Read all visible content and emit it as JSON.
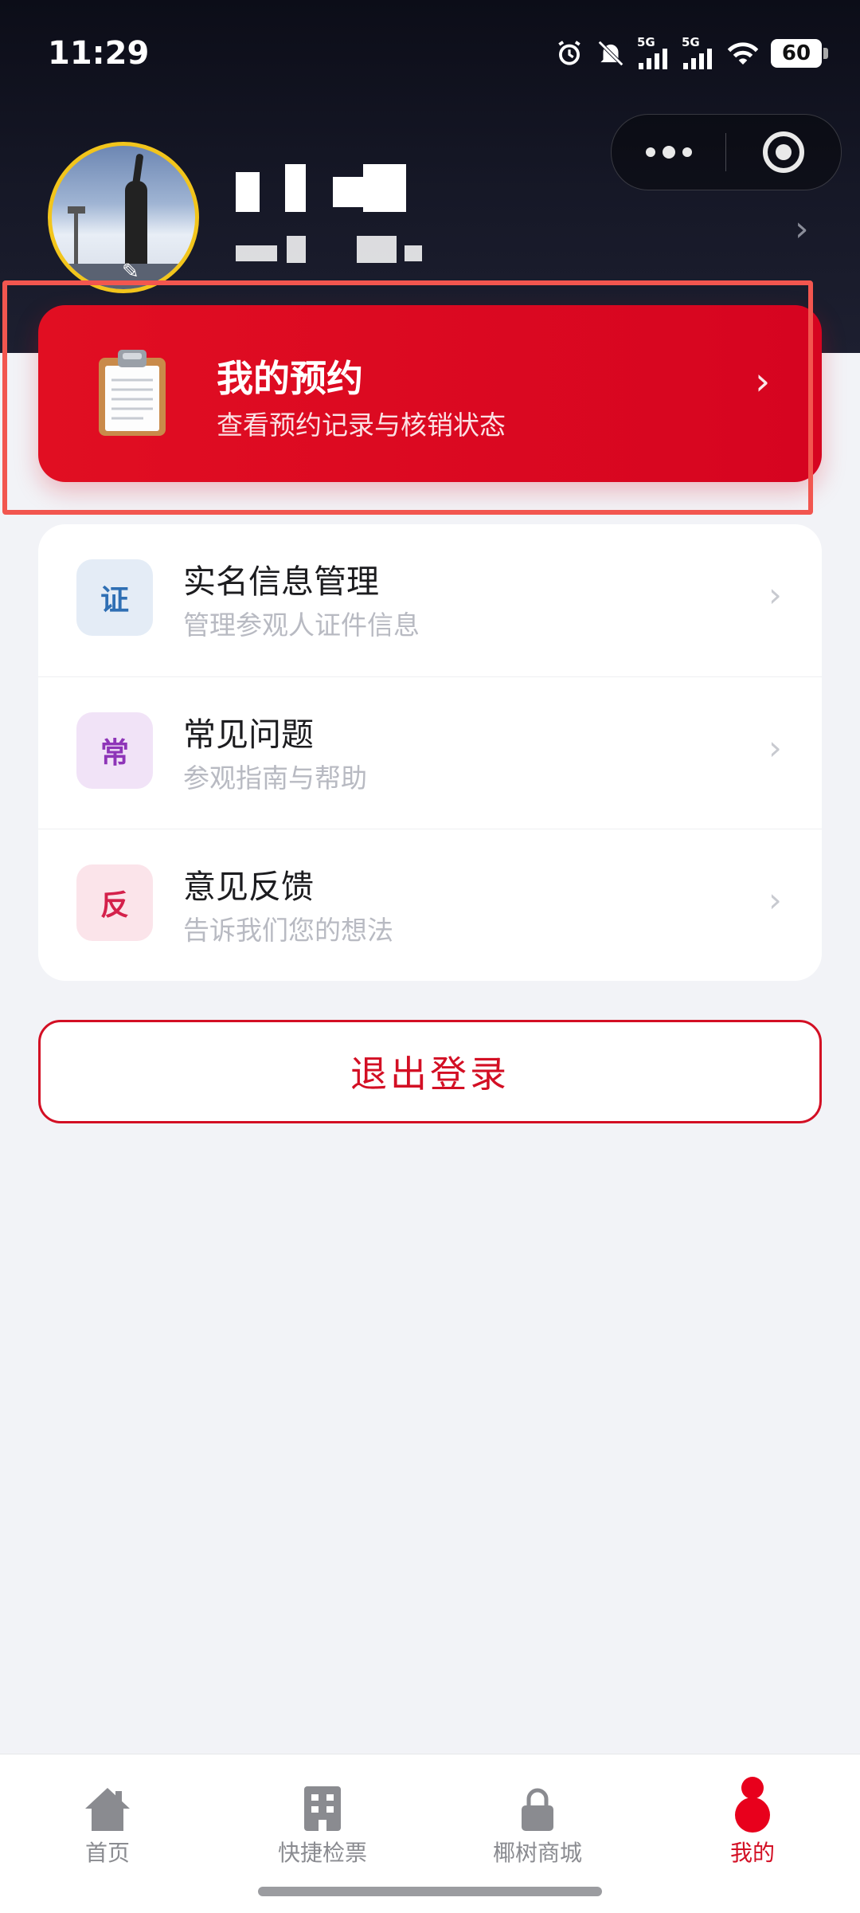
{
  "status_bar": {
    "time": "11:29",
    "battery": "60",
    "network_1": "5G",
    "network_2": "5G"
  },
  "profile": {},
  "reservation": {
    "title": "我的预约",
    "subtitle": "查看预约记录与核销状态",
    "icon": "clipboard-icon"
  },
  "menu": [
    {
      "badge": "证",
      "title": "实名信息管理",
      "subtitle": "管理参观人证件信息",
      "badge_color": "#2f6fb4",
      "badge_bg": "#e4ecf6"
    },
    {
      "badge": "常",
      "title": "常见问题",
      "subtitle": "参观指南与帮助",
      "badge_color": "#8e35b8",
      "badge_bg": "#f1e3f7"
    },
    {
      "badge": "反",
      "title": "意见反馈",
      "subtitle": "告诉我们您的想法",
      "badge_color": "#d4214b",
      "badge_bg": "#fbe4ea"
    }
  ],
  "logout": {
    "label": "退出登录"
  },
  "tabs": [
    {
      "label": "首页",
      "icon": "home-icon"
    },
    {
      "label": "快捷检票",
      "icon": "building-icon"
    },
    {
      "label": "椰树商城",
      "icon": "lock-bag-icon"
    },
    {
      "label": "我的",
      "icon": "person-icon",
      "active": true
    }
  ],
  "colors": {
    "accent": "#d30f24",
    "header_bg": "#161827",
    "page_bg": "#f2f3f7"
  }
}
